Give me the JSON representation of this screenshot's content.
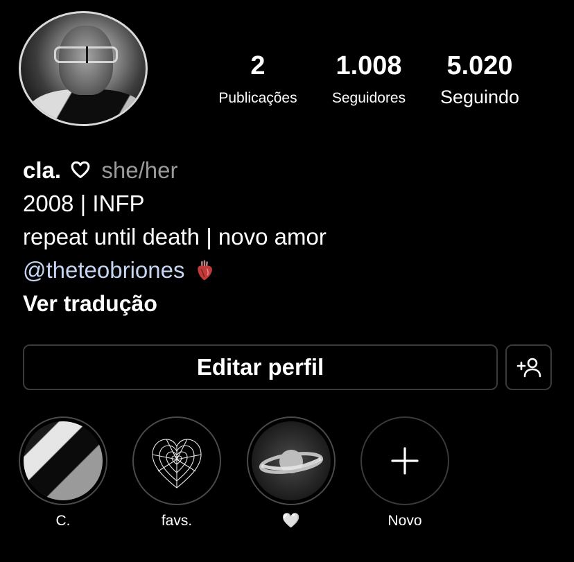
{
  "stats": [
    {
      "value": "2",
      "label": "Publicações"
    },
    {
      "value": "1.008",
      "label": "Seguidores"
    },
    {
      "value": "5.020",
      "label": "Seguindo"
    }
  ],
  "bio": {
    "name": "cla.",
    "pronouns": "she/her",
    "line1": "2008 | INFP",
    "line2": "repeat until death | novo amor",
    "mention": "@theteobriones",
    "translate": "Ver tradução"
  },
  "actions": {
    "edit_profile": "Editar perfil"
  },
  "highlights": [
    {
      "label": "C.",
      "icon": "photo-thumbnail"
    },
    {
      "label": "favs.",
      "icon": "spiderweb-heart"
    },
    {
      "label": "🤍",
      "icon": "saturn-photo"
    },
    {
      "label": "Novo",
      "icon": "plus-icon"
    }
  ],
  "colors": {
    "background": "#000000",
    "text": "#ffffff",
    "muted": "#9a9a9a",
    "mention": "#c6d5f2",
    "border": "#3a3a3a"
  }
}
